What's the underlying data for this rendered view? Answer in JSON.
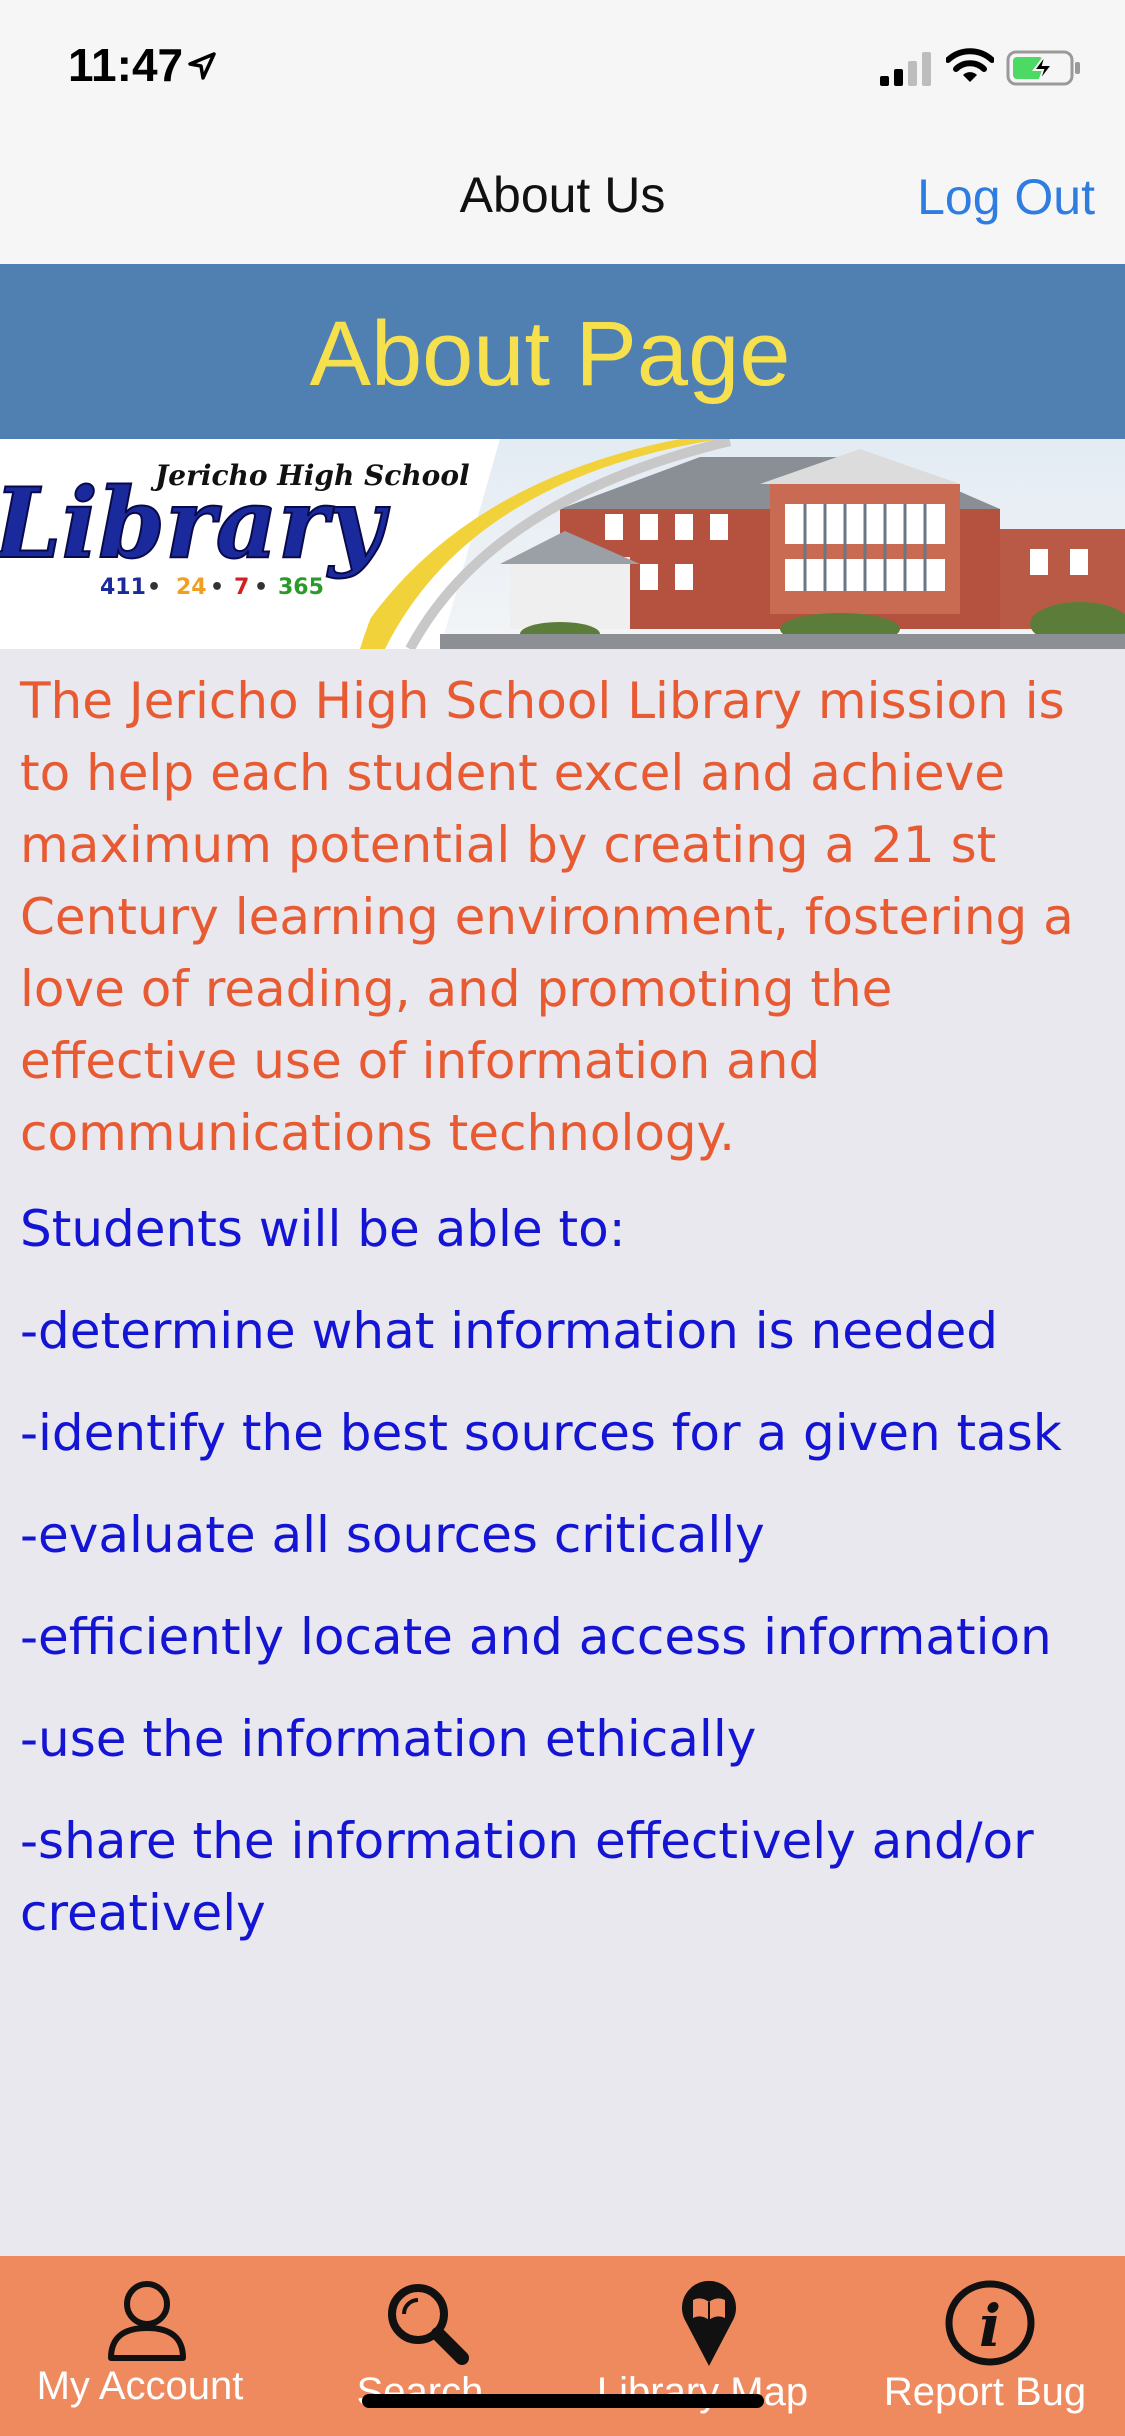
{
  "status_bar": {
    "time": "11:47",
    "icons": [
      "location-arrow-icon",
      "cellular-signal-icon",
      "wifi-icon",
      "battery-charging-icon"
    ]
  },
  "nav": {
    "title": "About Us",
    "logout_label": "Log Out",
    "accent_color": "#2f7de1"
  },
  "header": {
    "title": "About Page",
    "background_color": "#5080b2",
    "title_color": "#f7e04e"
  },
  "banner": {
    "school_name": "Jericho High School",
    "library_word": "Library",
    "hours_parts": [
      "411",
      "24",
      "7",
      "365"
    ]
  },
  "content": {
    "mission": "The Jericho High School Library mission is to help each student excel and achieve maximum potential by creating a 21 st Century learning environment, fostering a love of reading, and promoting the effective use of information and communications technology.",
    "goals_heading": "Students will be able to:",
    "goals": [
      "-determine what information is needed",
      "-identify the best sources for a given task",
      "-evaluate all sources critically",
      "-efficiently locate and access information",
      "-use the information ethically",
      "-share the information effectively and/or creatively"
    ],
    "mission_color": "#e85a32",
    "goals_color": "#1414d4"
  },
  "tabs": [
    {
      "label": "My Account",
      "icon": "person-icon"
    },
    {
      "label": "Search",
      "icon": "magnifier-icon"
    },
    {
      "label": "Library Map",
      "icon": "map-pin-book-icon"
    },
    {
      "label": "Report Bug",
      "icon": "info-icon"
    }
  ],
  "tab_bar_color": "#ef8a5f"
}
